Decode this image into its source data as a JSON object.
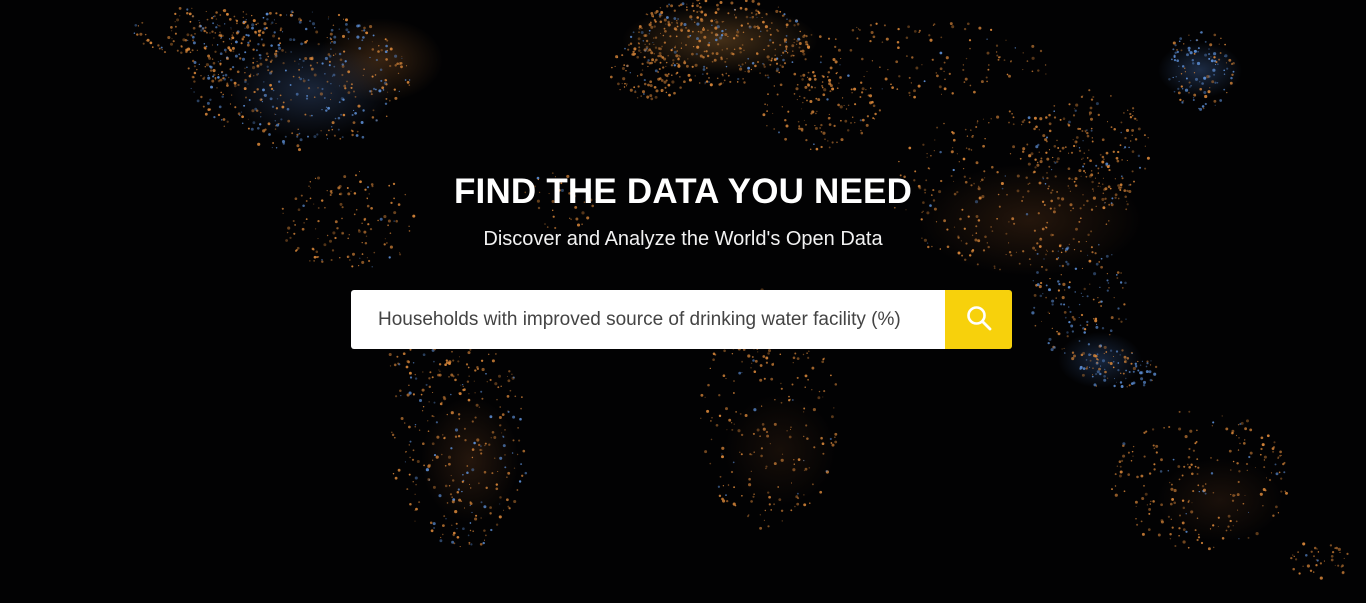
{
  "hero": {
    "title": "FIND THE DATA YOU NEED",
    "subtitle": "Discover and Analyze the World's Open Data"
  },
  "search": {
    "value": "Households with improved source of drinking water facility (%)",
    "button_icon": "search-icon"
  },
  "colors": {
    "background": "#000000",
    "accent": "#f7d10c",
    "city_light_orange": "#d9873a",
    "city_light_blue": "#5d8fd6"
  }
}
